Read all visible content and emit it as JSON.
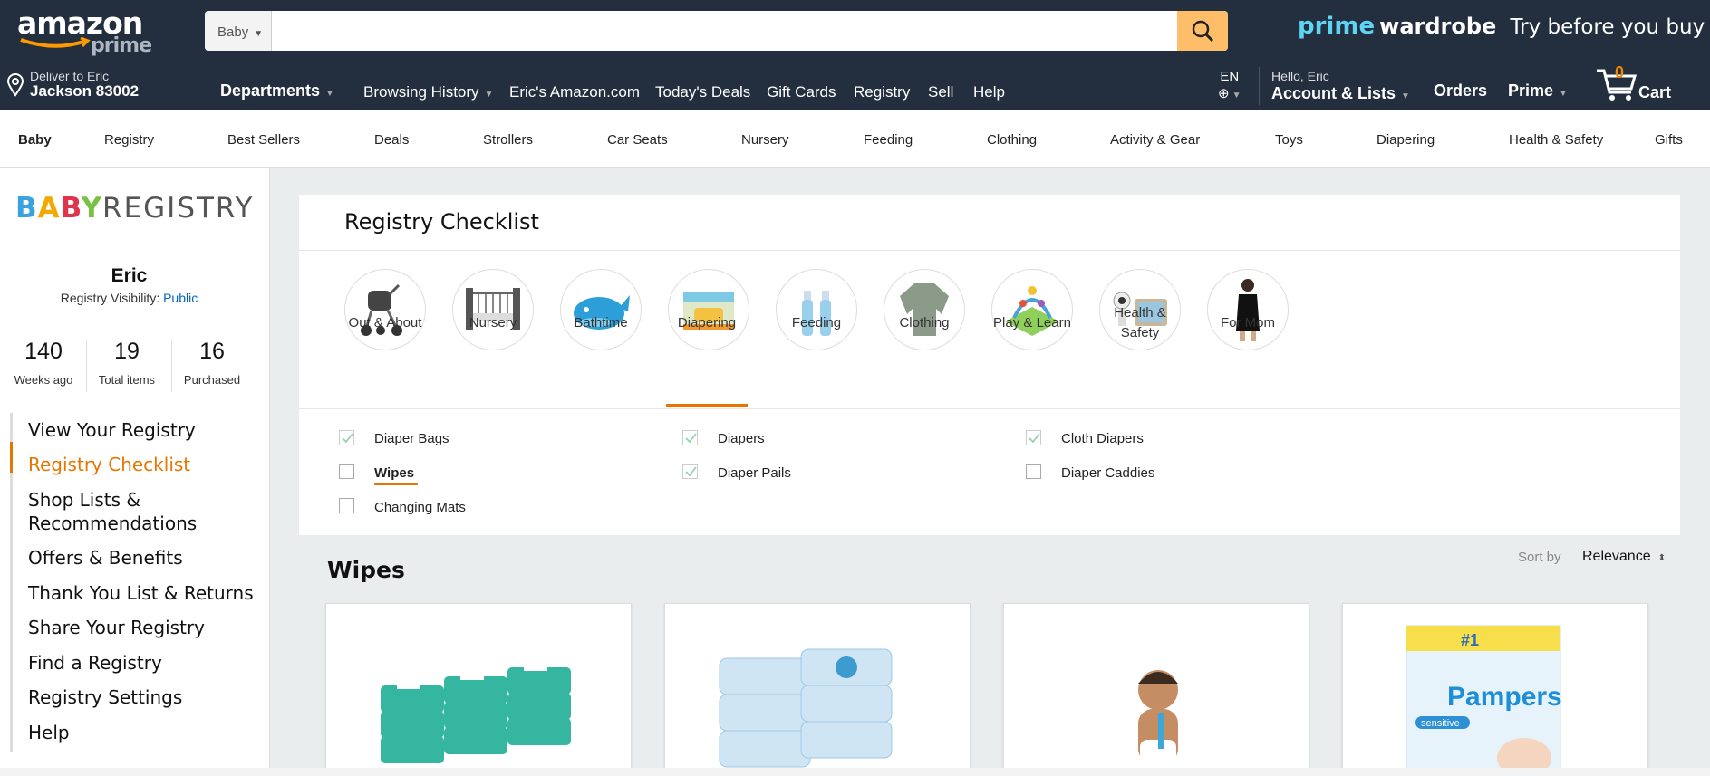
{
  "header": {
    "logo_main": "amazon",
    "logo_sub": "prime",
    "search": {
      "category": "Baby",
      "value": "",
      "placeholder": ""
    },
    "promo": {
      "part1": "prime",
      "part2": "wardrobe",
      "part3": "Try before you buy"
    },
    "deliver": {
      "line1": "Deliver to Eric",
      "line2": "Jackson 83002"
    },
    "departments": "Departments",
    "nav": [
      "Browsing History",
      "Eric's Amazon.com",
      "Today's Deals",
      "Gift Cards",
      "Registry",
      "Sell",
      "Help"
    ],
    "lang": "EN",
    "account": {
      "line1": "Hello, Eric",
      "line2": "Account & Lists"
    },
    "orders": "Orders",
    "prime": "Prime",
    "cart": {
      "count": "0",
      "label": "Cart"
    }
  },
  "subnav": [
    "Baby",
    "Registry",
    "Best Sellers",
    "Deals",
    "Strollers",
    "Car Seats",
    "Nursery",
    "Feeding",
    "Clothing",
    "Activity & Gear",
    "Toys",
    "Diapering",
    "Health & Safety",
    "Gifts"
  ],
  "sidebar": {
    "brand_baby": "BABY",
    "brand_registry": "REGISTRY",
    "name": "Eric",
    "visibility_label": "Registry Visibility:",
    "visibility_value": "Public",
    "stats": [
      {
        "value": "140",
        "label": "Weeks ago"
      },
      {
        "value": "19",
        "label": "Total items"
      },
      {
        "value": "16",
        "label": "Purchased"
      }
    ],
    "menu": [
      "View Your Registry",
      "Registry Checklist",
      "Shop Lists &",
      "Recommendations",
      "Offers & Benefits",
      "Thank You List & Returns",
      "Share Your Registry",
      "Find a Registry",
      "Registry Settings",
      "Help"
    ]
  },
  "checklist": {
    "title": "Registry Checklist",
    "categories": [
      "Out & About",
      "Nursery",
      "Bathtime",
      "Diapering",
      "Feeding",
      "Clothing",
      "Play & Learn",
      "Health &",
      "Safety",
      "For Mom"
    ],
    "active_category": "Diapering",
    "items": [
      {
        "label": "Diaper Bags",
        "checked": true
      },
      {
        "label": "Diapers",
        "checked": true
      },
      {
        "label": "Cloth Diapers",
        "checked": true
      },
      {
        "label": "Wipes",
        "checked": false
      },
      {
        "label": "Diaper Pails",
        "checked": true
      },
      {
        "label": "Diaper Caddies",
        "checked": false
      },
      {
        "label": "Changing Mats",
        "checked": false
      }
    ]
  },
  "section": {
    "title": "Wipes",
    "sort_label": "Sort by",
    "sort_value": "Relevance"
  },
  "products": [
    {
      "image": "wipes-packs-green"
    },
    {
      "image": "wipes-packs-blue"
    },
    {
      "image": "baby-photo"
    },
    {
      "image": "pampers-box",
      "brand": "Pampers",
      "badge": "#1",
      "variant": "sensitive"
    }
  ],
  "colors": {
    "accent": "#e77600",
    "header_bg": "#232f3e",
    "search_btn": "#febd69",
    "link": "#0066c0"
  }
}
